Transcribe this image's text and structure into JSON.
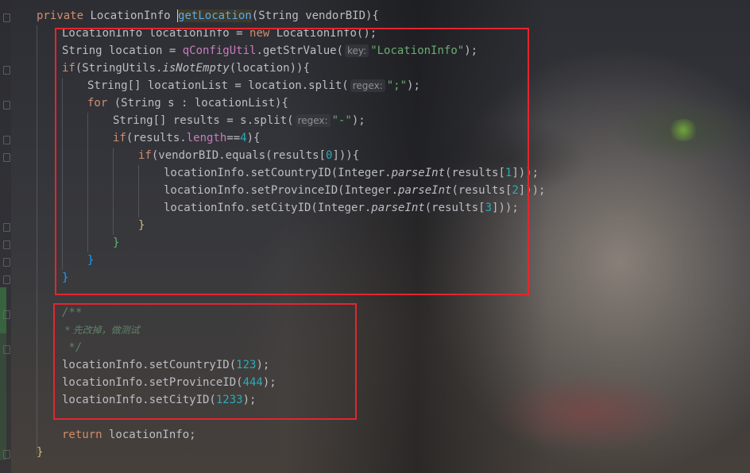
{
  "editor": {
    "signature": {
      "kw_private": "private",
      "return_type": "LocationInfo",
      "method_name": "getLocation",
      "params": "(String vendorBID){"
    },
    "block1": {
      "l1_a": "LocationInfo locationInfo = ",
      "l1_new": "new",
      "l1_b": " LocationInfo();",
      "l2_a": "String location = ",
      "l2_field": "qConfigUtil",
      "l2_b": ".getStrValue(",
      "l2_hint": "key:",
      "l2_str": "\"LocationInfo\"",
      "l2_c": ");",
      "l3_kw": "if",
      "l3_a": "(StringUtils.",
      "l3_it": "isNotEmpty",
      "l3_b": "(location)){",
      "l4_a": "String[] locationList = location.split(",
      "l4_hint": "regex:",
      "l4_str": "\";\"",
      "l4_b": ");",
      "l5_kw": "for",
      "l5_a": " (String s : locationList){",
      "l6_a": "String[] results = s.split(",
      "l6_hint": "regex:",
      "l6_str": "\"-\"",
      "l6_b": ");",
      "l7_kw": "if",
      "l7_a": "(results.",
      "l7_len": "length",
      "l7_b": "==",
      "l7_num": "4",
      "l7_c": "){",
      "l8_kw": "if",
      "l8_a": "(vendorBID.equals(results[",
      "l8_num": "0",
      "l8_b": "])){",
      "l9_a": "locationInfo.setCountryID(Integer.",
      "l9_it": "parseInt",
      "l9_b": "(results[",
      "l9_num": "1",
      "l9_c": "]));",
      "l10_a": "locationInfo.setProvinceID(Integer.",
      "l10_it": "parseInt",
      "l10_b": "(results[",
      "l10_num": "2",
      "l10_c": "]));",
      "l11_a": "locationInfo.setCityID(Integer.",
      "l11_it": "parseInt",
      "l11_b": "(results[",
      "l11_num": "3",
      "l11_c": "]));",
      "close1": "}",
      "close2": "}",
      "close3": "}",
      "close4": "}"
    },
    "block2": {
      "c1": "/**",
      "c2": " * 先改掉，做测试",
      "c3": " */",
      "s1_a": "locationInfo.setCountryID(",
      "s1_num": "123",
      "s1_b": ");",
      "s2_a": "locationInfo.setProvinceID(",
      "s2_num": "444",
      "s2_b": ");",
      "s3_a": "locationInfo.setCityID(",
      "s3_num": "1233",
      "s3_b": ");"
    },
    "ret_kw": "return",
    "ret_a": " locationInfo;",
    "final_close": "}"
  },
  "colors": {
    "annotation_box": "#e3262e",
    "keyword": "#cf8e6d",
    "string": "#6aab73",
    "number": "#2aacb8",
    "field": "#c77dbb"
  }
}
